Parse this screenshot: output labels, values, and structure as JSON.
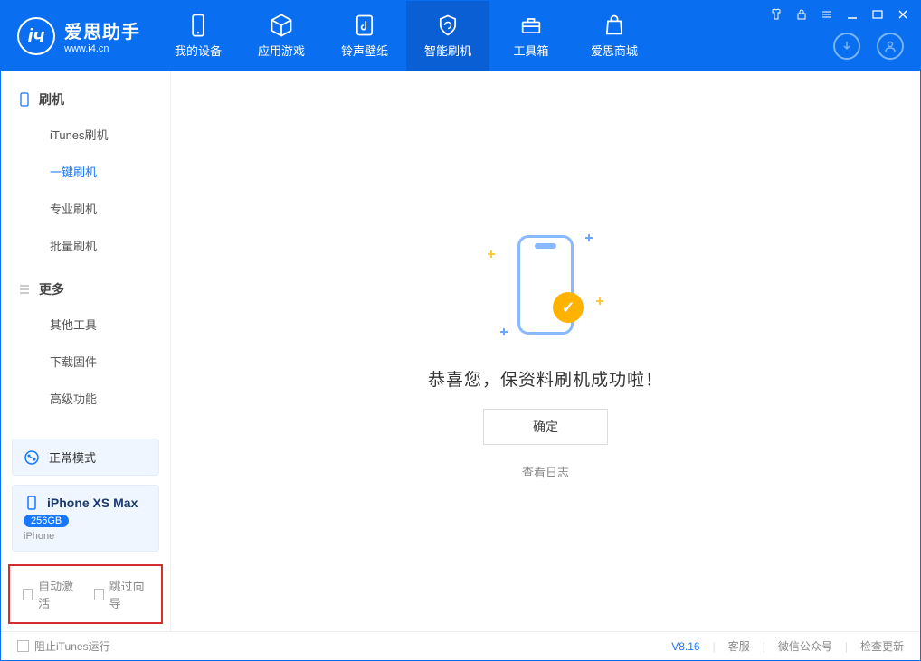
{
  "app": {
    "name": "爱思助手",
    "url": "www.i4.cn"
  },
  "nav": {
    "device": "我的设备",
    "apps": "应用游戏",
    "ring": "铃声壁纸",
    "flash": "智能刷机",
    "tools": "工具箱",
    "mall": "爱思商城"
  },
  "sidebar": {
    "group_flash": "刷机",
    "items_flash": {
      "itunes": "iTunes刷机",
      "onekey": "一键刷机",
      "pro": "专业刷机",
      "batch": "批量刷机"
    },
    "group_more": "更多",
    "items_more": {
      "other": "其他工具",
      "firmware": "下载固件",
      "advanced": "高级功能"
    }
  },
  "mode_card": {
    "label": "正常模式"
  },
  "device_card": {
    "name": "iPhone XS Max",
    "capacity": "256GB",
    "type": "iPhone"
  },
  "red_box": {
    "auto_activate": "自动激活",
    "skip_guide": "跳过向导"
  },
  "main": {
    "success": "恭喜您，保资料刷机成功啦！",
    "ok": "确定",
    "view_log": "查看日志"
  },
  "footer": {
    "block_itunes": "阻止iTunes运行",
    "version": "V8.16",
    "service": "客服",
    "wechat": "微信公众号",
    "update": "检查更新"
  }
}
